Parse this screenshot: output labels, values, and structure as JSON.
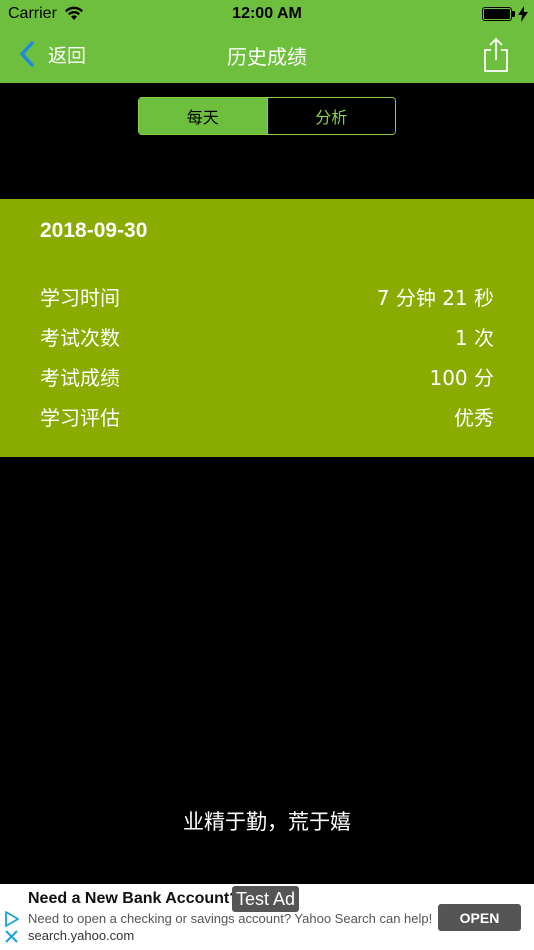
{
  "status_bar": {
    "carrier": "Carrier",
    "time": "12:00 AM"
  },
  "nav": {
    "back_label": "返回",
    "title": "历史成绩"
  },
  "segments": {
    "daily": "每天",
    "analysis": "分析",
    "selected": "每天"
  },
  "record": {
    "date": "2018-09-30",
    "rows": [
      {
        "label": "学习时间",
        "value": "7 分钟 21 秒"
      },
      {
        "label": "考试次数",
        "value": "1 次"
      },
      {
        "label": "考试成绩",
        "value": "100 分"
      },
      {
        "label": "学习评估",
        "value": "优秀"
      }
    ]
  },
  "motto": "业精于勤，荒于嬉",
  "ad": {
    "headline": "Need a New Bank Account?",
    "tag": "Test Ad",
    "body": "Need to open a checking or savings account? Yahoo Search can help!",
    "domain": "search.yahoo.com",
    "cta": "OPEN"
  },
  "colors": {
    "nav_green": "#6fbf3e",
    "card_green": "#8aab00",
    "segment_border": "#8ccf4b",
    "back_chevron": "#1e88e5"
  }
}
